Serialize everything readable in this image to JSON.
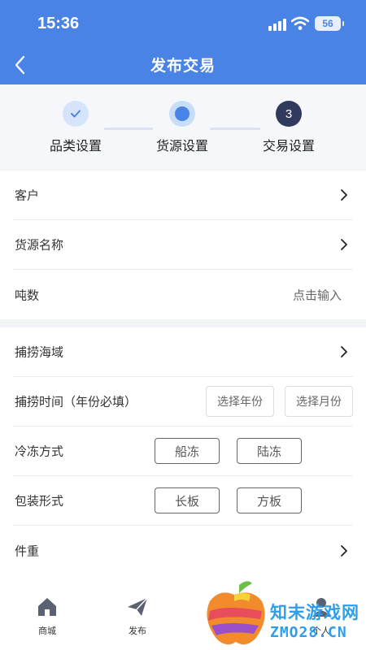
{
  "status": {
    "time": "15:36",
    "battery": "56"
  },
  "nav": {
    "title": "发布交易"
  },
  "steps": [
    {
      "label": "品类设置",
      "state": "done"
    },
    {
      "label": "货源设置",
      "state": "active"
    },
    {
      "label": "交易设置",
      "state": "pending",
      "number": "3"
    }
  ],
  "section1": {
    "customer_label": "客户",
    "product_label": "货源名称",
    "tonnage_label": "吨数",
    "tonnage_placeholder": "点击输入"
  },
  "section2": {
    "sea_area_label": "捕捞海域",
    "catch_time_label": "捕捞时间（年份必填）",
    "select_year": "选择年份",
    "select_month": "选择月份",
    "freeze_label": "冷冻方式",
    "freeze_options": [
      "船冻",
      "陆冻"
    ],
    "package_label": "包装形式",
    "package_options": [
      "长板",
      "方板"
    ],
    "piece_weight_label": "件重"
  },
  "tabbar": {
    "items": [
      {
        "label": "商城"
      },
      {
        "label": "发布"
      },
      {
        "label": "个人"
      }
    ]
  },
  "watermark": {
    "cn": "知末游戏网",
    "en": "ZMO28.CN"
  },
  "colors": {
    "primary": "#4a83e6",
    "step_next": "#313a5c",
    "watermark": "#2f9ee8"
  }
}
